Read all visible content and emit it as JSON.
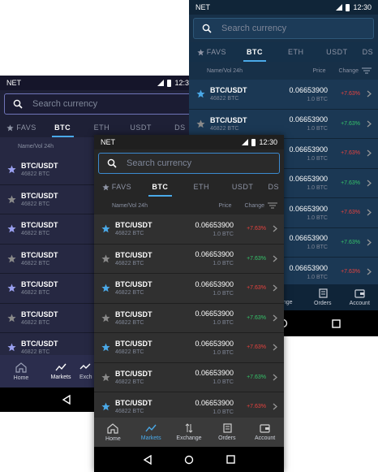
{
  "colors": {
    "accent": "#4aa9e8",
    "up": "#35c46a",
    "down": "#e8433f",
    "star_on": "#4aa9e8",
    "star_off": "#8a8a8a",
    "star_purple": "#9aa0f0"
  },
  "status": {
    "carrier": "NET",
    "time": "12:30"
  },
  "search": {
    "placeholder": "Search currency"
  },
  "tabs": {
    "favs": "FAVS",
    "btc": "BTC",
    "eth": "ETH",
    "usdt": "USDT",
    "ds": "DS"
  },
  "columns": {
    "name": "Name/Vol 24h",
    "price": "Price",
    "change": "Change"
  },
  "rows": [
    {
      "symbol": "BTC/USDT",
      "volume": "46822 BTC",
      "price": "0.06653900",
      "amount": "1.0 BTC",
      "change": "+7.63%",
      "dir": "down",
      "starred": true
    },
    {
      "symbol": "BTC/USDT",
      "volume": "46822 BTC",
      "price": "0.06653900",
      "amount": "1.0 BTC",
      "change": "+7.63%",
      "dir": "up",
      "starred": false
    },
    {
      "symbol": "BTC/USDT",
      "volume": "46822 BTC",
      "price": "0.06653900",
      "amount": "1.0 BTC",
      "change": "+7.63%",
      "dir": "down",
      "starred": true
    },
    {
      "symbol": "BTC/USDT",
      "volume": "46822 BTC",
      "price": "0.06653900",
      "amount": "1.0 BTC",
      "change": "+7.63%",
      "dir": "up",
      "starred": false
    },
    {
      "symbol": "BTC/USDT",
      "volume": "46822 BTC",
      "price": "0.06653900",
      "amount": "1.0 BTC",
      "change": "+7.63%",
      "dir": "down",
      "starred": true
    },
    {
      "symbol": "BTC/USDT",
      "volume": "46822 BTC",
      "price": "0.06653900",
      "amount": "1.0 BTC",
      "change": "+7.63%",
      "dir": "up",
      "starred": false
    },
    {
      "symbol": "BTC/USDT",
      "volume": "46822 BTC",
      "price": "0.06653900",
      "amount": "1.0 BTC",
      "change": "+7.63%",
      "dir": "down",
      "starred": true
    }
  ],
  "nav": {
    "home": "Home",
    "markets": "Markets",
    "exchange": "Exchange",
    "exchange_cut": "Exch",
    "exchange_tail": "ange",
    "orders": "Orders",
    "account": "Account"
  },
  "icons": {
    "search": "search-icon",
    "star": "star-icon",
    "chevron": "chevron-right-icon",
    "filter": "sort-icon",
    "home": "home-icon",
    "markets": "chart-line-icon",
    "exchange": "swap-icon",
    "orders": "orders-icon",
    "account": "wallet-icon",
    "back": "back-triangle-icon",
    "homebtn": "home-circle-icon",
    "recents": "recents-square-icon"
  }
}
